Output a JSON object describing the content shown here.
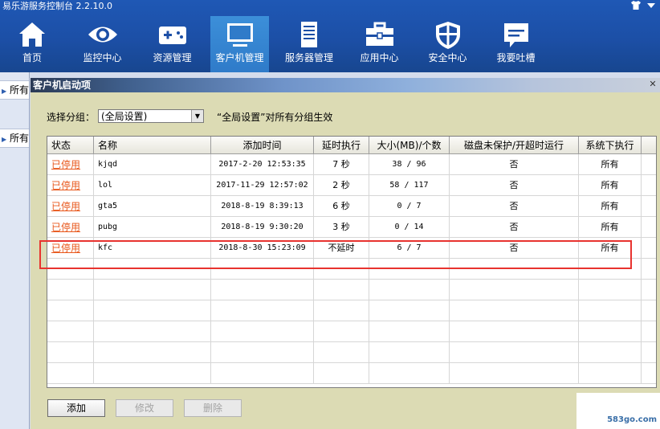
{
  "app": {
    "title": "易乐游服务控制台 2.2.10.0"
  },
  "nav": [
    {
      "label": "首页",
      "icon": "home-icon"
    },
    {
      "label": "监控中心",
      "icon": "eye-icon"
    },
    {
      "label": "资源管理",
      "icon": "gamepad-icon"
    },
    {
      "label": "客户机管理",
      "icon": "monitor-icon"
    },
    {
      "label": "服务器管理",
      "icon": "server-icon"
    },
    {
      "label": "应用中心",
      "icon": "briefcase-icon"
    },
    {
      "label": "安全中心",
      "icon": "shield-icon"
    },
    {
      "label": "我要吐槽",
      "icon": "chat-icon"
    }
  ],
  "nav_active": "客户机管理",
  "sidebar": {
    "items": [
      {
        "label": "所有"
      },
      {
        "label": "所有"
      }
    ]
  },
  "panel": {
    "title": "客户机启动项",
    "close_glyph": "✕",
    "filter_label": "选择分组：",
    "filter_value": "(全局设置)",
    "hint": "“全局设置”对所有分组生效"
  },
  "table": {
    "columns": [
      "状态",
      "名称",
      "添加时间",
      "延时执行",
      "大小(MB)/个数",
      "磁盘未保护/开超时运行",
      "系统下执行"
    ],
    "rows": [
      {
        "status": "已停用",
        "name": "kjqd",
        "time": "2017-2-20 12:53:35",
        "delay": "7 秒",
        "size": "38 / 96",
        "disk": "否",
        "exec": "所有"
      },
      {
        "status": "已停用",
        "name": "lol",
        "time": "2017-11-29 12:57:02",
        "delay": "2 秒",
        "size": "58 / 117",
        "disk": "否",
        "exec": "所有"
      },
      {
        "status": "已停用",
        "name": "gta5",
        "time": "2018-8-19 8:39:13",
        "delay": "6 秒",
        "size": "0 / 7",
        "disk": "否",
        "exec": "所有"
      },
      {
        "status": "已停用",
        "name": "pubg",
        "time": "2018-8-19 9:30:20",
        "delay": "3 秒",
        "size": "0 / 14",
        "disk": "否",
        "exec": "所有"
      },
      {
        "status": "已停用",
        "name": "kfc",
        "time": "2018-8-30 15:23:09",
        "delay": "不延时",
        "size": "6 / 7",
        "disk": "否",
        "exec": "所有"
      }
    ],
    "highlighted_row": "kfc"
  },
  "buttons": {
    "add": "添加",
    "edit": "修改",
    "delete": "删除"
  },
  "watermark": "583go.com",
  "colors": {
    "topbar": "#1f58b5",
    "nav_active": "#3c8fd9",
    "status_link": "#e8571b",
    "highlight_border": "#e8332f",
    "panel_bg": "#dcdbb4"
  }
}
